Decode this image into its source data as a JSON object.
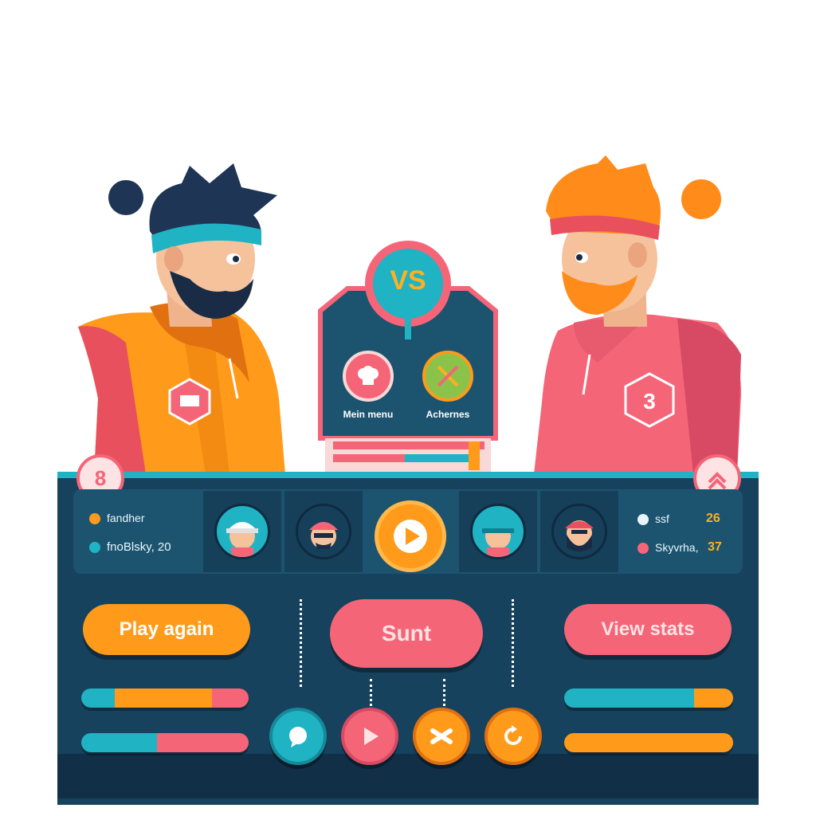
{
  "center_sign": {
    "vs_label": "VS",
    "menu_items": [
      {
        "label": "Mein menu",
        "icon": "chef-hat-icon"
      },
      {
        "label": "Achernes",
        "icon": "crossed-swords-icon"
      }
    ]
  },
  "players": {
    "left": {
      "badge": "8",
      "stats": [
        {
          "text": "fandher"
        },
        {
          "text": "fnoBlsky, 20"
        }
      ]
    },
    "right": {
      "badge": "crossed-arrows-icon",
      "jacket_badge": "3",
      "stats": [
        {
          "text": "ssf",
          "value": "26"
        },
        {
          "text": "Skyvrha,",
          "value": "37"
        }
      ]
    }
  },
  "buttons": {
    "play_again": "Play again",
    "start": "Sunt",
    "view_stats": "View stats"
  },
  "round_buttons": [
    {
      "icon": "chat-bubble-icon",
      "color": "#1fb3c4"
    },
    {
      "icon": "play-icon",
      "color": "#f56578"
    },
    {
      "icon": "crossed-bones-icon",
      "color": "#ff9a1a"
    },
    {
      "icon": "refresh-icon",
      "color": "#ff9a1a"
    }
  ],
  "colors": {
    "panel": "#17425e",
    "teal": "#1fb3c4",
    "orange": "#ff9a1a",
    "pink": "#f56578"
  }
}
